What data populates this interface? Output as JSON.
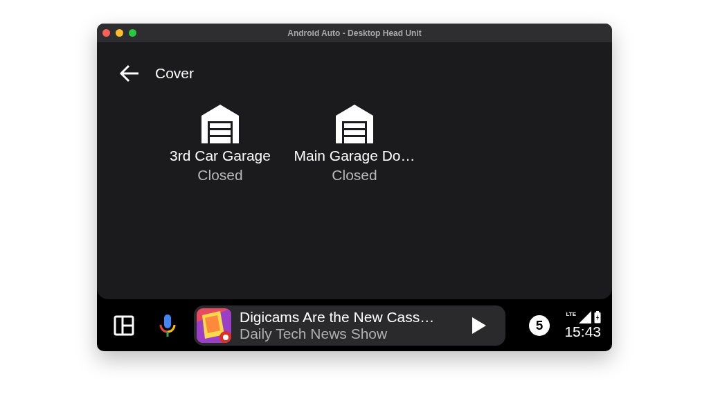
{
  "window": {
    "title": "Android Auto - Desktop Head Unit"
  },
  "header": {
    "title": "Cover"
  },
  "devices": [
    {
      "name": "3rd Car Garage",
      "state": "Closed"
    },
    {
      "name": "Main Garage Do…",
      "state": "Closed"
    }
  ],
  "media": {
    "title": "Digicams Are the New Cass…",
    "subtitle": "Daily Tech News Show"
  },
  "notifications": {
    "count": "5"
  },
  "status": {
    "network": "LTE",
    "time": "15:43"
  }
}
